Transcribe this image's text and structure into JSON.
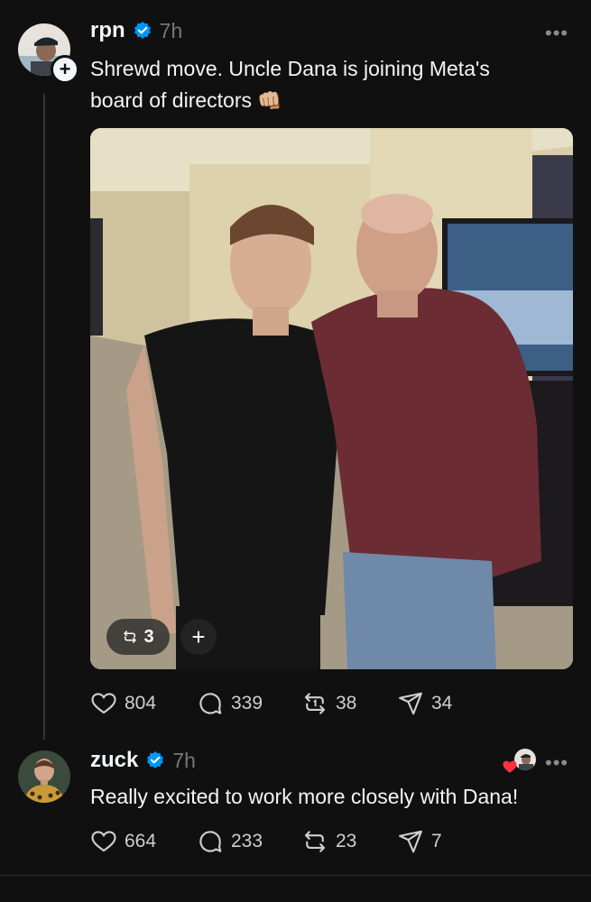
{
  "post1": {
    "username": "rpn",
    "time": "7h",
    "text_line1": "Shrewd move. Uncle Dana is joining Meta's",
    "text_line2": "board of directors",
    "emoji": "👊🏼",
    "more": "•••",
    "photo": {
      "repost_count": "3",
      "plus_label": "+"
    },
    "actions": {
      "likes": "804",
      "replies": "339",
      "reposts": "38",
      "shares": "34"
    }
  },
  "post2": {
    "username": "zuck",
    "time": "7h",
    "text": "Really excited to work more closely with Dana!",
    "more": "•••",
    "actions": {
      "likes": "664",
      "replies": "233",
      "reposts": "23",
      "shares": "7"
    }
  },
  "colors": {
    "background": "#101010",
    "verified": "#0095f6",
    "muted": "#777777",
    "heart": "#ff3040"
  },
  "icons": [
    "verified-icon",
    "heart-icon",
    "reply-icon",
    "repost-icon",
    "share-icon",
    "more-icon",
    "plus-icon"
  ]
}
